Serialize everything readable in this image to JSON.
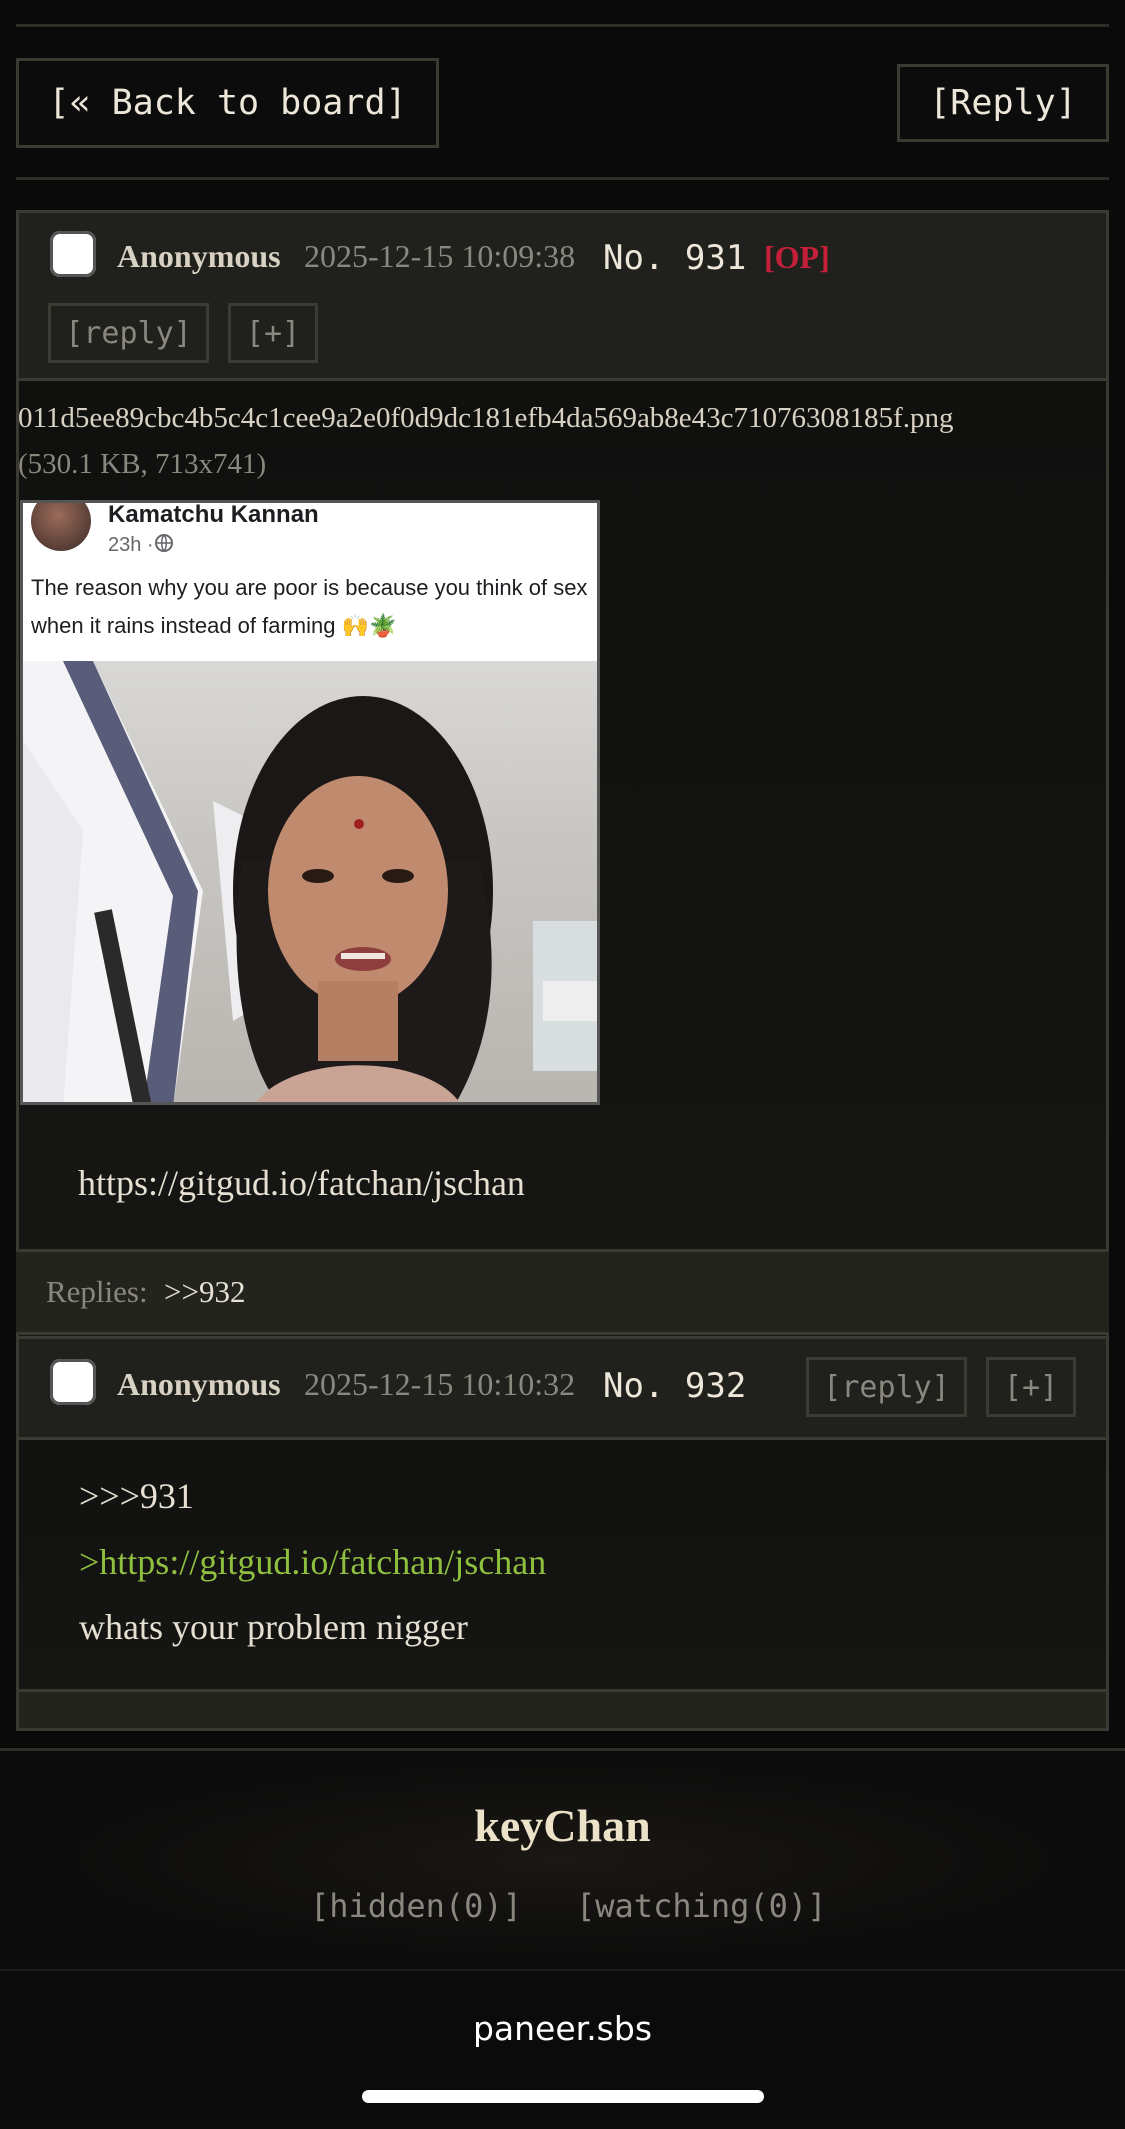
{
  "nav": {
    "back_label": "[« Back to board]",
    "reply_label": "[Reply]"
  },
  "op_post": {
    "author": "Anonymous",
    "timestamp": "2025-12-15 10:09:38",
    "number": "No. 931",
    "op_tag": "[OP]",
    "reply_btn": "[reply]",
    "expand_btn": "[+]",
    "file_name": "011d5ee89cbc4b5c4c1cee9a2e0f0d9dc181efb4da569ab8e43c71076308185f.png",
    "file_meta": "(530.1 KB, 713x741)",
    "image": {
      "fb_name": "Kamatchu Kannan",
      "fb_meta": "23h · ",
      "fb_text": "The reason why you are poor is because you think of sex when it rains instead of farming 🙌🪴"
    },
    "body": "https://gitgud.io/fatchan/jschan",
    "replies_label": "Replies:",
    "replies_link": ">>932"
  },
  "reply_post": {
    "author": "Anonymous",
    "timestamp": "2025-12-15 10:10:32",
    "number": "No. 932",
    "reply_btn": "[reply]",
    "expand_btn": "[+]",
    "quote_link": ">>>931",
    "greentext": ">https://gitgud.io/fatchan/jschan",
    "body": "whats your problem nigger"
  },
  "footer": {
    "site_title": "keyChan",
    "hidden": "[hidden(0)]",
    "watching": "[watching(0)]"
  },
  "browser": {
    "domain": "paneer.sbs"
  },
  "colors": {
    "background": "#0a0a0a",
    "header_bg": "#20201d",
    "border": "#3a3a33",
    "op_tag": "#c5203a",
    "greentext": "#8fbf3f"
  }
}
